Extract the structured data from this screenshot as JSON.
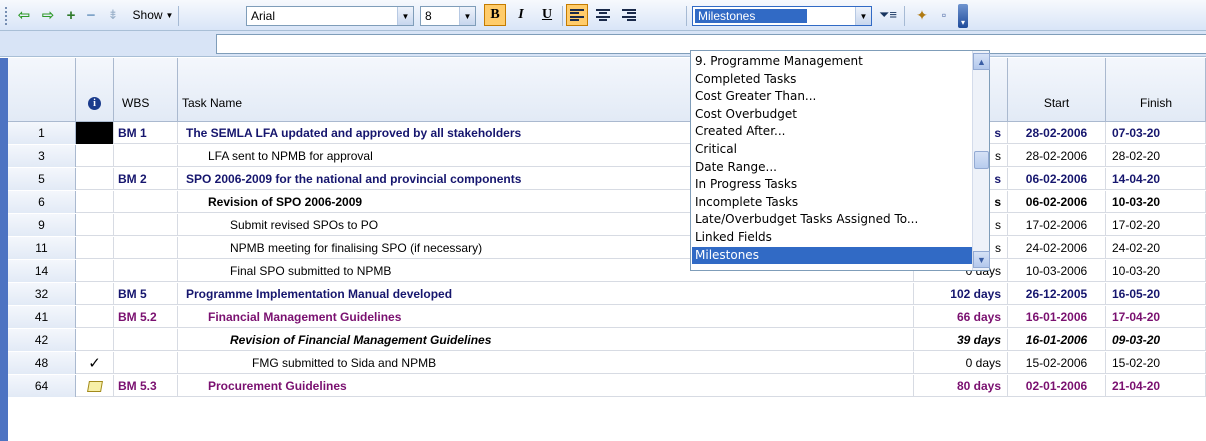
{
  "toolbar": {
    "show_label": "Show",
    "font_name": "Arial",
    "font_size": "8",
    "bold_label": "B",
    "italic_label": "I",
    "underline_label": "U",
    "filter_value": "Milestones"
  },
  "grid": {
    "headers": {
      "indicator_icon": "info-icon",
      "wbs": "WBS",
      "task_name": "Task Name",
      "start": "Start",
      "finish": "Finish"
    },
    "rows": [
      {
        "id": "1",
        "ind": "black-cell",
        "wbs": "BM 1",
        "name": "The SEMLA LFA updated and approved by all stakeholders",
        "dur": "s",
        "start": "28-02-2006",
        "finish": "07-03-20",
        "level": "lvl0",
        "indent": 0
      },
      {
        "id": "3",
        "ind": "",
        "wbs": "",
        "name": "LFA sent to NPMB for approval",
        "dur": "s",
        "start": "28-02-2006",
        "finish": "28-02-20",
        "level": "norm",
        "indent": 1
      },
      {
        "id": "5",
        "ind": "",
        "wbs": "BM 2",
        "name": "SPO 2006-2009 for the national and provincial components",
        "dur": "s",
        "start": "06-02-2006",
        "finish": "14-04-20",
        "level": "lvl0",
        "indent": 0
      },
      {
        "id": "6",
        "ind": "",
        "wbs": "",
        "name": "Revision of SPO 2006-2009",
        "dur": "s",
        "start": "06-02-2006",
        "finish": "10-03-20",
        "level": "lvl2",
        "indent": 1
      },
      {
        "id": "9",
        "ind": "",
        "wbs": "",
        "name": "Submit revised SPOs to PO",
        "dur": "s",
        "start": "17-02-2006",
        "finish": "17-02-20",
        "level": "norm",
        "indent": 2
      },
      {
        "id": "11",
        "ind": "",
        "wbs": "",
        "name": "NPMB meeting for finalising SPO (if necessary)",
        "dur": "s",
        "start": "24-02-2006",
        "finish": "24-02-20",
        "level": "norm",
        "indent": 2
      },
      {
        "id": "14",
        "ind": "",
        "wbs": "",
        "name": "Final SPO submitted to NPMB",
        "dur": "0 days",
        "start": "10-03-2006",
        "finish": "10-03-20",
        "level": "norm",
        "indent": 2
      },
      {
        "id": "32",
        "ind": "",
        "wbs": "BM 5",
        "name": "Programme Implementation Manual developed",
        "dur": "102 days",
        "start": "26-12-2005",
        "finish": "16-05-20",
        "level": "lvl0",
        "indent": 0
      },
      {
        "id": "41",
        "ind": "",
        "wbs": "BM 5.2",
        "name": "Financial Management Guidelines",
        "dur": "66 days",
        "start": "16-01-2006",
        "finish": "17-04-20",
        "level": "lvl1",
        "indent": 1
      },
      {
        "id": "42",
        "ind": "",
        "wbs": "",
        "name": "Revision of Financial Management Guidelines",
        "dur": "39 days",
        "start": "16-01-2006",
        "finish": "09-03-20",
        "level": "lvl2i",
        "indent": 2
      },
      {
        "id": "48",
        "ind": "check",
        "wbs": "",
        "name": "FMG submitted to Sida and NPMB",
        "dur": "0 days",
        "start": "15-02-2006",
        "finish": "15-02-20",
        "level": "norm",
        "indent": 3
      },
      {
        "id": "64",
        "ind": "note",
        "wbs": "BM 5.3",
        "name": "Procurement Guidelines",
        "dur": "80 days",
        "start": "02-01-2006",
        "finish": "21-04-20",
        "level": "lvl1",
        "indent": 1
      }
    ]
  },
  "dropdown": {
    "items": [
      "9. Programme Management",
      "Completed Tasks",
      "Cost Greater Than...",
      "Cost Overbudget",
      "Created After...",
      "Critical",
      "Date Range...",
      "In Progress Tasks",
      "Incomplete Tasks",
      "Late/Overbudget Tasks Assigned To...",
      "Linked Fields",
      "Milestones"
    ],
    "selected_index": 11
  }
}
